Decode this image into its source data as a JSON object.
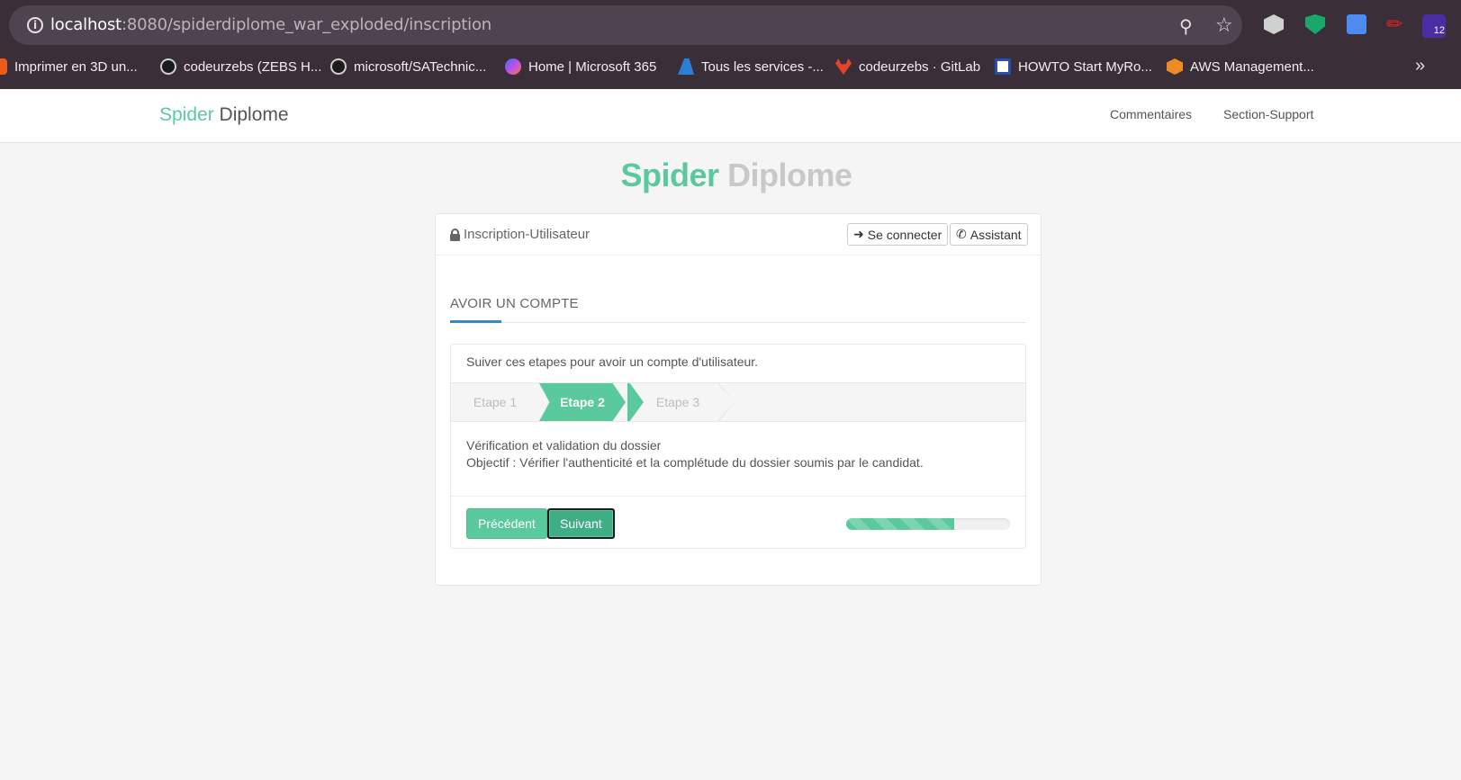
{
  "browser": {
    "url_host": "localhost",
    "url_rest": ":8080/spiderdiplome_war_exploded/inscription",
    "bookmarks": [
      {
        "label": "Imprimer en 3D un...",
        "color": "#e85d1a"
      },
      {
        "label": "codeurzebs (ZEBS H...",
        "color": "#1b1b1b"
      },
      {
        "label": "microsoft/SATechnic...",
        "color": "#1b1b1b"
      },
      {
        "label": "Home | Microsoft 365",
        "color": "#7b5cf0"
      },
      {
        "label": "Tous les services -...",
        "color": "#2b7fd6"
      },
      {
        "label": "codeurzebs · GitLab",
        "color": "#e24329"
      },
      {
        "label": "HOWTO Start MyRo...",
        "color": "#ffffff"
      },
      {
        "label": "AWS Management...",
        "color": "#f08a24"
      }
    ],
    "extension_badge": "12"
  },
  "navbar": {
    "brand_green": "Spider",
    "brand_dark": "Diplome",
    "links": [
      "Commentaires",
      "Section-Support"
    ]
  },
  "hero": {
    "green": "Spider",
    "grey": "Diplome"
  },
  "panel": {
    "title": "Inscription-Utilisateur",
    "login_button": "Se connecter",
    "assistant_button": "Assistant",
    "section_title": "AVOIR UN COMPTE",
    "intro": "Suiver ces etapes pour avoir un compte d'utilisateur.",
    "steps": [
      "Etape 1",
      "Etape 2",
      "Etape 3"
    ],
    "active_step": 2,
    "desc_title": "Vérification et validation du dossier",
    "desc_body": "Objectif : Vérifier l'authenticité et la complétude du dossier soumis par le candidat.",
    "prev_button": "Précédent",
    "next_button": "Suivant",
    "progress_percent": 66
  },
  "colors": {
    "accent": "#5bc99e",
    "blue_accent": "#3a87c6"
  }
}
